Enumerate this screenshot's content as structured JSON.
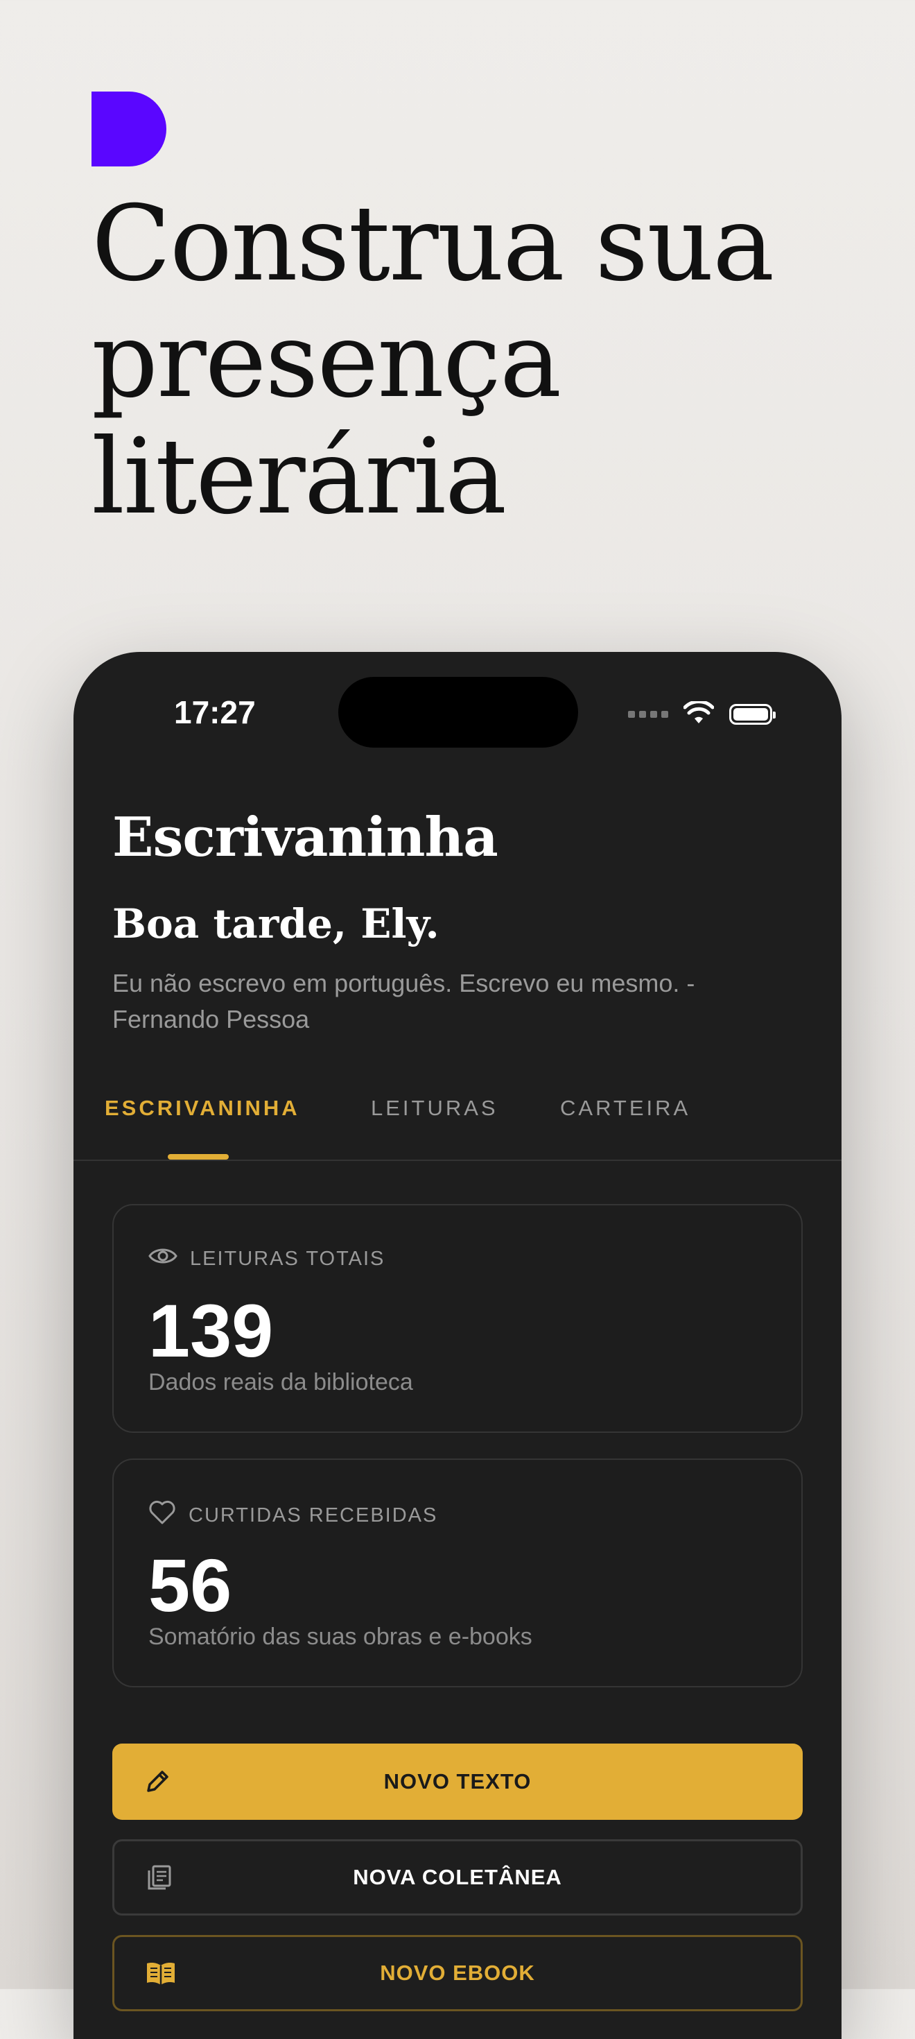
{
  "promo": {
    "headline": "Construa sua presença literária",
    "brand_color": "#5a06ff"
  },
  "status_bar": {
    "time": "17:27"
  },
  "app": {
    "title": "Escrivaninha",
    "greeting": "Boa tarde, Ely.",
    "quote": "Eu não escrevo em português. Escrevo eu mesmo. - Fernando Pessoa"
  },
  "tabs": [
    {
      "label": "ESCRIVANINHA",
      "active": true
    },
    {
      "label": "LEITURAS",
      "active": false
    },
    {
      "label": "CARTEIRA",
      "active": false
    }
  ],
  "stats": [
    {
      "icon": "eye-icon",
      "label": "LEITURAS TOTAIS",
      "value": "139",
      "subtitle": "Dados reais da biblioteca"
    },
    {
      "icon": "heart-icon",
      "label": "CURTIDAS RECEBIDAS",
      "value": "56",
      "subtitle": "Somatório das suas obras e e-books"
    }
  ],
  "actions": {
    "new_text": {
      "label": "NOVO TEXTO",
      "icon": "pencil-icon"
    },
    "new_collection": {
      "label": "NOVA COLETÂNEA",
      "icon": "collection-icon"
    },
    "new_ebook": {
      "label": "NOVO EBOOK",
      "icon": "book-icon"
    }
  },
  "colors": {
    "accent": "#e2ae36",
    "background": "#1e1e1e"
  }
}
